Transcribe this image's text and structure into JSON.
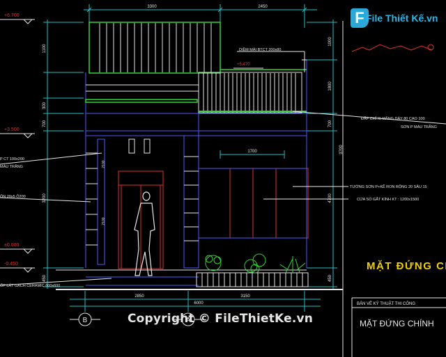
{
  "watermark": {
    "logo_letter": "F",
    "logo_text": "File Thiết Kế.vn",
    "copyright": "Copyright © FileThietKe.vn"
  },
  "levels": {
    "top": "+6.700",
    "upper": "+3.500",
    "roof_mid": "+5.470",
    "floor": "±0.000",
    "ground": "-0.450"
  },
  "top_dims": [
    "3300",
    "2450"
  ],
  "bottom_dims": [
    "2850",
    "3150"
  ],
  "bottom_total": "6000",
  "left_dims": [
    "1100",
    "300",
    "700",
    "1350",
    "3200",
    "450"
  ],
  "right_dims": [
    "1000",
    "1800",
    "700",
    "3700",
    "4700",
    "450"
  ],
  "inner_dims": [
    "1700",
    "2100",
    "2100"
  ],
  "annotations": {
    "railing": "DIỀM MÁI BTCT 200x80",
    "awning": "ĐẮP CHỈ XI MĂNG DÀY 80 CAO 100",
    "awning2": "SƠN P MÀU TRẮNG",
    "wall": "TƯỜNG SƠN P+KẼ RON RỘNG 20 SÂU 15",
    "window": "CỬA SỔ GẮT KÍNH KT : 1200x1500",
    "left_top": "P CT 100x200",
    "left_top2": "MÀU TRẮNG",
    "left_mid": "ÔN 20x5 Ô200",
    "left_bottom": "ỐP LÁT GẠCH CERAMIC 600x600"
  },
  "elevation_title_partial": "MẶT ĐỨNG CH",
  "title_block": {
    "header": "BẢN VẼ KỸ THUẬT THI CÔNG",
    "title": "MẶT ĐỨNG CHÍNH"
  },
  "axes": [
    "B",
    "A"
  ],
  "colors": {
    "line_white": "#e8e8e8",
    "line_blue": "#4a5cff",
    "line_green": "#33d633",
    "dim_cyan": "#20c0c8",
    "text_yellow": "#f0d000",
    "line_red": "#e03030"
  }
}
